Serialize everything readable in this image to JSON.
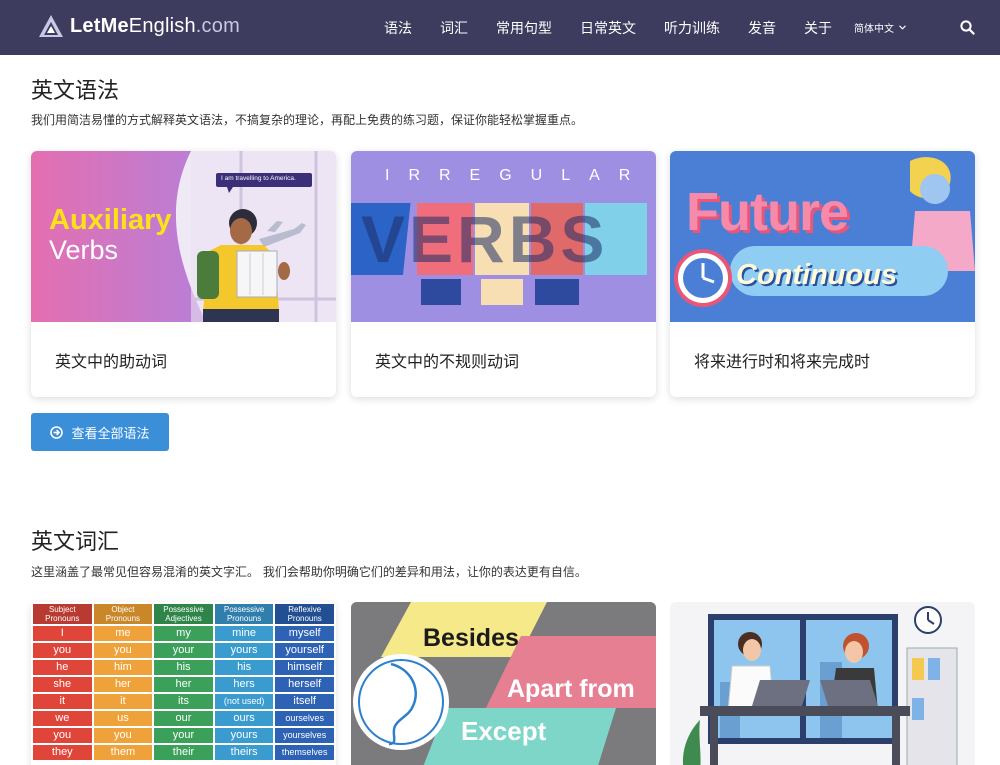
{
  "header": {
    "logo_bold": "LetMe",
    "logo_mid": "English",
    "logo_light": ".com",
    "menu": [
      "语法",
      "词汇",
      "常用句型",
      "日常英文",
      "听力训练",
      "发音",
      "关于"
    ],
    "language": "简体中文",
    "colors": {
      "nav_bg": "#3d3b5e",
      "accent": "#3b8fd9"
    }
  },
  "grammar": {
    "title": "英文语法",
    "description": "我们用简洁易懂的方式解释英文语法，不搞复杂的理论，再配上免费的练习题，保证你能轻松掌握重点。",
    "cards": [
      {
        "title": "英文中的助动词",
        "img_line1": "Auxiliary",
        "img_line2": "Verbs",
        "bubble": "I am travelling to America."
      },
      {
        "title": "英文中的不规则动词",
        "img_top": "IRREGULAR",
        "img_main": "VERBS"
      },
      {
        "title": "将来进行时和将来完成时",
        "img_line1": "Future",
        "img_line2": "Continuous"
      }
    ],
    "view_all": "查看全部语法"
  },
  "vocab": {
    "title": "英文词汇",
    "description": "这里涵盖了最常见但容易混淆的英文字汇。 我们会帮助你明确它们的差异和用法，让你的表达更有自信。",
    "pronoun_table": {
      "headers": [
        "Subject Pronouns",
        "Object Pronouns",
        "Possessive Adjectives",
        "Possessive Pronouns",
        "Reflexive Pronouns"
      ],
      "rows": [
        [
          "I",
          "me",
          "my",
          "mine",
          "myself"
        ],
        [
          "you",
          "you",
          "your",
          "yours",
          "yourself"
        ],
        [
          "he",
          "him",
          "his",
          "his",
          "himself"
        ],
        [
          "she",
          "her",
          "her",
          "hers",
          "herself"
        ],
        [
          "it",
          "it",
          "its",
          "(not used)",
          "itself"
        ],
        [
          "we",
          "us",
          "our",
          "ours",
          "ourselves"
        ],
        [
          "you",
          "you",
          "your",
          "yours",
          "yourselves"
        ],
        [
          "they",
          "them",
          "their",
          "theirs",
          "themselves"
        ]
      ]
    },
    "card2": {
      "w1": "Besides",
      "w2": "Apart from",
      "w3": "Except"
    }
  }
}
